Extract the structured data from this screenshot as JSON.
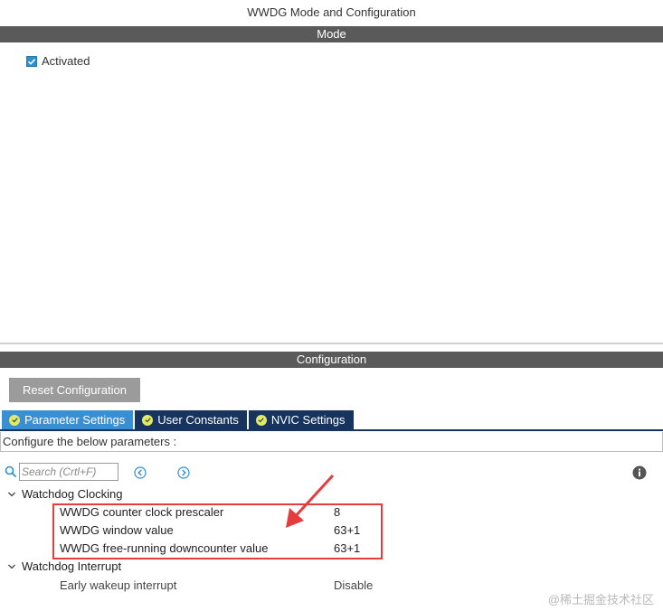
{
  "window": {
    "title": "WWDG Mode and Configuration"
  },
  "mode": {
    "header": "Mode",
    "activated": {
      "label": "Activated",
      "checked": true
    }
  },
  "configuration": {
    "header": "Configuration",
    "reset_label": "Reset Configuration",
    "tabs": [
      {
        "label": "Parameter Settings",
        "active": true,
        "icon": "check-circle-icon"
      },
      {
        "label": "User Constants",
        "active": false,
        "icon": "check-circle-icon"
      },
      {
        "label": "NVIC Settings",
        "active": false,
        "icon": "check-circle-icon"
      }
    ],
    "configure_text": "Configure the below parameters :",
    "search": {
      "placeholder": "Search (Crtl+F)",
      "value": ""
    },
    "groups": [
      {
        "name": "Watchdog Clocking",
        "expanded": true,
        "params": [
          {
            "name": "WWDG counter clock prescaler",
            "value": "8"
          },
          {
            "name": "WWDG window value",
            "value": "63+1"
          },
          {
            "name": "WWDG free-running downcounter value",
            "value": "63+1"
          }
        ]
      },
      {
        "name": "Watchdog Interrupt",
        "expanded": true,
        "params": [
          {
            "name": "Early wakeup interrupt",
            "value": "Disable"
          }
        ]
      }
    ]
  },
  "colors": {
    "section_bar": "#5a5a5a",
    "tab_active": "#3a8fd3",
    "tab_inactive": "#17345f",
    "highlight": "#e53d3d",
    "checkbox": "#2c8fce"
  },
  "watermark": "@稀土掘金技术社区"
}
